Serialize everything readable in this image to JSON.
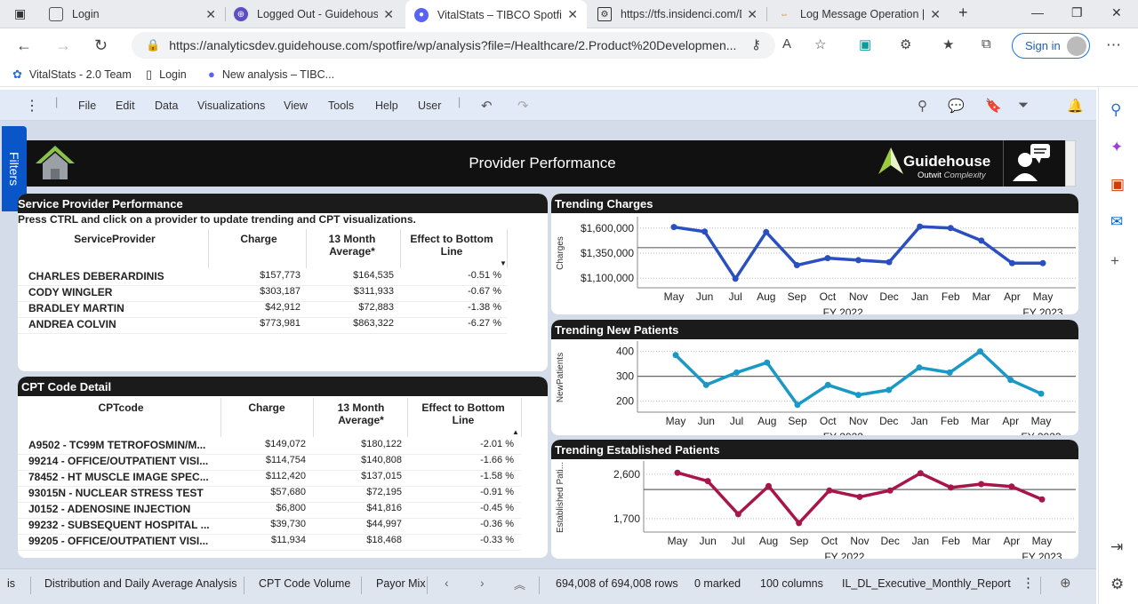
{
  "browser": {
    "tabs": [
      {
        "title": "Login",
        "icon": "page-icon"
      },
      {
        "title": "Logged Out - Guidehouse",
        "icon": "guidehouse-icon"
      },
      {
        "title": "VitalStats – TIBCO Spotfire",
        "icon": "spotfire-icon"
      },
      {
        "title": "https://tfs.insidenci.com/D",
        "icon": "tfs-icon"
      },
      {
        "title": "Log Message Operation |",
        "icon": "log-icon"
      }
    ],
    "url": "https://analyticsdev.guidehouse.com/spotfire/wp/analysis?file=/Healthcare/2.Product%20Developmen...",
    "sign_in": "Sign in",
    "bookmarks": [
      "VitalStats - 2.0 Team",
      "Login",
      "New analysis – TIBC..."
    ]
  },
  "app": {
    "menu": [
      "File",
      "Edit",
      "Data",
      "Visualizations",
      "View",
      "Tools",
      "Help",
      "User"
    ],
    "filters_label": "Filters",
    "header_title": "Provider Performance",
    "logo_name": "Guidehouse",
    "logo_tagline_a": "Outwit",
    "logo_tagline_b": "Complexity"
  },
  "provider_panel": {
    "title": "Service Provider Performance",
    "instruction": "Press CTRL and click on a provider to update trending and CPT visualizations.",
    "columns": [
      "ServiceProvider",
      "Charge",
      "13 Month Average*",
      "Effect to Bottom Line"
    ],
    "rows": [
      [
        "CHARLES DEBERARDINIS",
        "$157,773",
        "$164,535",
        "-0.51 %"
      ],
      [
        "CODY WINGLER",
        "$303,187",
        "$311,933",
        "-0.67 %"
      ],
      [
        "BRADLEY MARTIN",
        "$42,912",
        "$72,883",
        "-1.38 %"
      ],
      [
        "ANDREA COLVIN",
        "$773,981",
        "$863,322",
        "-6.27 %"
      ]
    ]
  },
  "cpt_panel": {
    "title": "CPT Code Detail",
    "columns": [
      "CPTcode",
      "Charge",
      "13 Month Average*",
      "Effect to Bottom Line"
    ],
    "rows": [
      [
        "A9502 - TC99M TETROFOSMIN/M...",
        "$149,072",
        "$180,122",
        "-2.01 %"
      ],
      [
        "99214 - OFFICE/OUTPATIENT VISI...",
        "$114,754",
        "$140,808",
        "-1.66 %"
      ],
      [
        "78452 - HT MUSCLE IMAGE SPEC...",
        "$112,420",
        "$137,015",
        "-1.58 %"
      ],
      [
        "93015N - NUCLEAR STRESS TEST",
        "$57,680",
        "$72,195",
        "-0.91 %"
      ],
      [
        "J0152 - ADENOSINE INJECTION",
        "$6,800",
        "$41,816",
        "-0.45 %"
      ],
      [
        "99232 - SUBSEQUENT HOSPITAL ...",
        "$39,730",
        "$44,997",
        "-0.36 %"
      ],
      [
        "99205 - OFFICE/OUTPATIENT VISI...",
        "$11,934",
        "$18,468",
        "-0.33 %"
      ]
    ]
  },
  "chart_data": [
    {
      "type": "line",
      "title": "Trending Charges",
      "ylabel": "Charges",
      "categories": [
        "May",
        "Jun",
        "Jul",
        "Aug",
        "Sep",
        "Oct",
        "Nov",
        "Dec",
        "Jan",
        "Feb",
        "Mar",
        "Apr",
        "May"
      ],
      "fiscal_labels": [
        "FY 2022",
        "FY 2023"
      ],
      "values": [
        1610000,
        1565000,
        1095000,
        1560000,
        1230000,
        1300000,
        1280000,
        1260000,
        1615000,
        1600000,
        1475000,
        1250000,
        1250000
      ],
      "reference_line": 1405000,
      "yticks": [
        1100000,
        1350000,
        1600000
      ],
      "ytick_labels": [
        "$1,100,000",
        "$1,350,000",
        "$1,600,000"
      ],
      "ylim": [
        1040000,
        1660000
      ],
      "color": "#2a4fc0"
    },
    {
      "type": "line",
      "title": "Trending New Patients",
      "ylabel": "NewPatients",
      "categories": [
        "May",
        "Jun",
        "Jul",
        "Aug",
        "Sep",
        "Oct",
        "Nov",
        "Dec",
        "Jan",
        "Feb",
        "Mar",
        "Apr",
        "May"
      ],
      "fiscal_labels": [
        "FY 2022",
        "FY 2023"
      ],
      "values": [
        385,
        265,
        315,
        355,
        185,
        265,
        225,
        245,
        335,
        315,
        400,
        285,
        230
      ],
      "reference_line": 300,
      "yticks": [
        200,
        300,
        400
      ],
      "ytick_labels": [
        "200",
        "300",
        "400"
      ],
      "ylim": [
        170,
        420
      ],
      "color": "#1a98c6"
    },
    {
      "type": "line",
      "title": "Trending Established Patients",
      "ylabel": "Established Pati...",
      "categories": [
        "May",
        "Jun",
        "Jul",
        "Aug",
        "Sep",
        "Oct",
        "Nov",
        "Dec",
        "Jan",
        "Feb",
        "Mar",
        "Apr",
        "May"
      ],
      "fiscal_labels": [
        "FY 2022",
        "FY 2023"
      ],
      "values": [
        2630,
        2460,
        1790,
        2360,
        1610,
        2270,
        2140,
        2270,
        2620,
        2330,
        2400,
        2350,
        2090
      ],
      "reference_line": 2290,
      "yticks": [
        1700,
        2600
      ],
      "ytick_labels": [
        "1,700",
        "2,600"
      ],
      "ylim": [
        1500,
        2760
      ],
      "color": "#a8154a"
    }
  ],
  "status_bar": {
    "tabs": [
      "is",
      "Distribution and Daily Average Analysis",
      "CPT Code Volume",
      "Payor Mix"
    ],
    "rows": "694,008 of 694,008 rows",
    "marked": "0 marked",
    "columns": "100 columns",
    "report": "IL_DL_Executive_Monthly_Report"
  }
}
